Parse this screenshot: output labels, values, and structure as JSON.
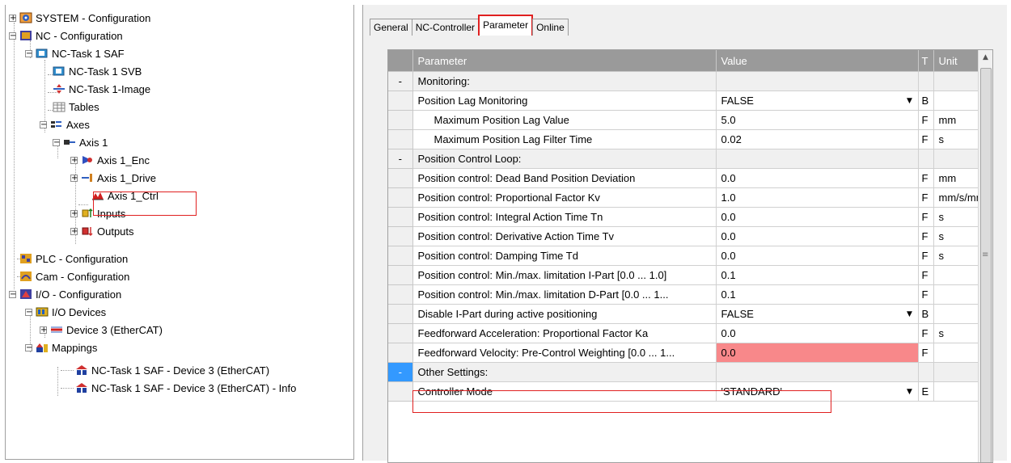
{
  "tree": {
    "system": "SYSTEM - Configuration",
    "nc": "NC - Configuration",
    "nctask": "NC-Task 1 SAF",
    "svb": "NC-Task 1 SVB",
    "image": "NC-Task 1-Image",
    "tables": "Tables",
    "axes": "Axes",
    "axis1": "Axis 1",
    "enc": "Axis 1_Enc",
    "drive": "Axis 1_Drive",
    "ctrl": "Axis 1_Ctrl",
    "inputs": "Inputs",
    "outputs": "Outputs",
    "plc": "PLC - Configuration",
    "cam": "Cam - Configuration",
    "io": "I/O - Configuration",
    "iodevices": "I/O Devices",
    "device3": "Device 3 (EtherCAT)",
    "mappings": "Mappings",
    "map1": "NC-Task 1 SAF - Device 3 (EtherCAT)",
    "map2": "NC-Task 1 SAF - Device 3 (EtherCAT) - Info"
  },
  "tabs": [
    "General",
    "NC-Controller",
    "Parameter",
    "Online"
  ],
  "grid": {
    "headers": {
      "parameter": "Parameter",
      "value": "Value",
      "t": "T",
      "unit": "Unit"
    },
    "rows": [
      {
        "g": "-",
        "p": "Monitoring:",
        "v": "",
        "t": "",
        "u": "",
        "cat": true
      },
      {
        "g": "",
        "p": "Position Lag Monitoring",
        "v": "FALSE",
        "t": "B",
        "u": "",
        "dd": true
      },
      {
        "g": "",
        "p": "Maximum Position Lag Value",
        "v": "5.0",
        "t": "F",
        "u": "mm",
        "ind": true
      },
      {
        "g": "",
        "p": "Maximum Position Lag Filter Time",
        "v": "0.02",
        "t": "F",
        "u": "s",
        "ind": true
      },
      {
        "g": "-",
        "p": "Position Control Loop:",
        "v": "",
        "t": "",
        "u": "",
        "cat": true
      },
      {
        "g": "",
        "p": "Position control: Dead Band Position Deviation",
        "v": "0.0",
        "t": "F",
        "u": "mm"
      },
      {
        "g": "",
        "p": "Position control: Proportional Factor Kv",
        "v": "1.0",
        "t": "F",
        "u": "mm/s/mm"
      },
      {
        "g": "",
        "p": "Position control: Integral Action Time Tn",
        "v": "0.0",
        "t": "F",
        "u": "s"
      },
      {
        "g": "",
        "p": "Position control: Derivative Action Time Tv",
        "v": "0.0",
        "t": "F",
        "u": "s"
      },
      {
        "g": "",
        "p": "Position control: Damping Time Td",
        "v": "0.0",
        "t": "F",
        "u": "s"
      },
      {
        "g": "",
        "p": "Position control: Min./max. limitation I-Part [0.0 ... 1.0]",
        "v": "0.1",
        "t": "F",
        "u": ""
      },
      {
        "g": "",
        "p": "Position control: Min./max. limitation D-Part [0.0 ... 1...",
        "v": "0.1",
        "t": "F",
        "u": ""
      },
      {
        "g": "",
        "p": "Disable I-Part during active positioning",
        "v": "FALSE",
        "t": "B",
        "u": "",
        "dd": true
      },
      {
        "g": "",
        "p": "Feedforward Acceleration: Proportional Factor Ka",
        "v": "0.0",
        "t": "F",
        "u": "s"
      },
      {
        "g": "",
        "p": "Feedforward Velocity: Pre-Control Weighting [0.0 ... 1...",
        "v": "0.0",
        "t": "F",
        "u": "",
        "hl": true
      },
      {
        "g": "-",
        "p": "Other Settings:",
        "v": "",
        "t": "",
        "u": "",
        "cat": true,
        "sel": true
      },
      {
        "g": "",
        "p": "Controller Mode",
        "v": "'STANDARD'",
        "t": "E",
        "u": "",
        "dd": true
      }
    ]
  },
  "colors": {
    "highlight": "#f8888a",
    "selected_gutter": "#3399ff",
    "red_outline": "#e02020",
    "header": "#9a9a9a"
  }
}
